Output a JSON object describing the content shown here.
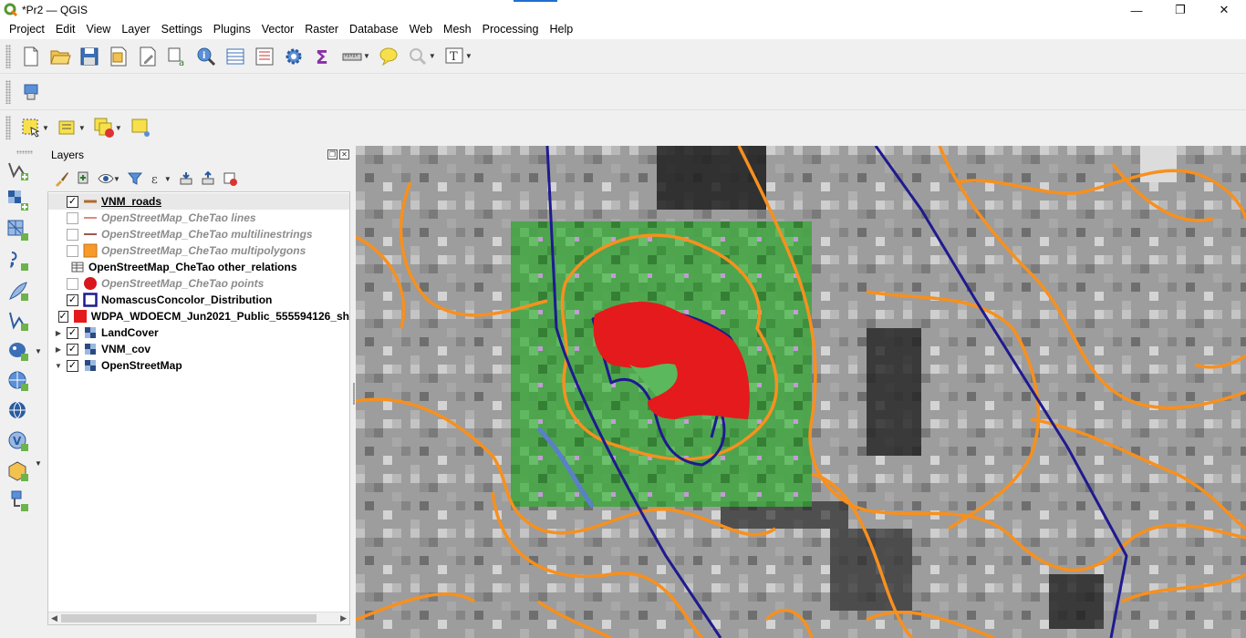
{
  "window": {
    "title": "*Pr2 — QGIS",
    "minimize": "—",
    "maximize": "❐",
    "close": "✕"
  },
  "menu": [
    "Project",
    "Edit",
    "View",
    "Layer",
    "Settings",
    "Plugins",
    "Vector",
    "Raster",
    "Database",
    "Web",
    "Mesh",
    "Processing",
    "Help"
  ],
  "layers_panel": {
    "title": "Layers",
    "layers": [
      {
        "name": "VNM_roads",
        "checked": true,
        "visible_style": "bold-underline",
        "symbol": "line-orange",
        "selected": true
      },
      {
        "name": "OpenStreetMap_CheTao lines",
        "checked": false,
        "visible_style": "dim",
        "symbol": "line-salmon"
      },
      {
        "name": "OpenStreetMap_CheTao multilinestrings",
        "checked": false,
        "visible_style": "dim",
        "symbol": "line-brown"
      },
      {
        "name": "OpenStreetMap_CheTao multipolygons",
        "checked": false,
        "visible_style": "dim",
        "symbol": "fill-orange"
      },
      {
        "name": "OpenStreetMap_CheTao other_relations",
        "checked": null,
        "visible_style": "normal",
        "symbol": "table"
      },
      {
        "name": "OpenStreetMap_CheTao points",
        "checked": false,
        "visible_style": "dim",
        "symbol": "point-red"
      },
      {
        "name": "NomascusConcolor_Distribution",
        "checked": true,
        "visible_style": "normal",
        "symbol": "outline-blue"
      },
      {
        "name": "WDPA_WDOECM_Jun2021_Public_555594126_sh",
        "checked": true,
        "visible_style": "normal",
        "symbol": "fill-red"
      },
      {
        "name": "LandCover",
        "checked": true,
        "visible_style": "normal",
        "symbol": "raster",
        "expandable": "collapsed"
      },
      {
        "name": "VNM_cov",
        "checked": true,
        "visible_style": "normal",
        "symbol": "raster",
        "expandable": "collapsed"
      },
      {
        "name": "OpenStreetMap",
        "checked": true,
        "visible_style": "normal",
        "symbol": "raster",
        "expandable": "expanded"
      }
    ]
  },
  "colors": {
    "roads": "#f7901e",
    "distribution": "#1f1a8f",
    "protected_area": "#e41a1c",
    "landcover_green": "#4aa54a"
  },
  "icons": {
    "toolbar1": [
      "new-project-icon",
      "open-project-icon",
      "save-project-icon",
      "save-as-icon",
      "print-layout-icon",
      "layout-manager-icon",
      "identify-icon",
      "attribute-table-icon",
      "field-calculator-icon",
      "settings-gear-icon",
      "statistics-sigma-icon",
      "measure-icon",
      "map-tips-icon",
      "zoom-tool-icon",
      "text-annotation-icon"
    ],
    "toolbar2": [
      "digitize-icon"
    ],
    "toolbar3": [
      "select-features-icon",
      "select-by-expression-icon",
      "deselect-icon",
      "identify-point-icon"
    ],
    "vertical": [
      "add-vector-layer-icon",
      "add-raster-layer-icon",
      "add-mesh-layer-icon",
      "add-delimited-text-icon",
      "add-gps-icon",
      "add-spatialite-icon",
      "add-postgis-icon",
      "add-wms-icon",
      "add-wfs-icon",
      "add-virtual-layer-icon",
      "add-wcs-icon",
      "new-layer-icon"
    ]
  }
}
